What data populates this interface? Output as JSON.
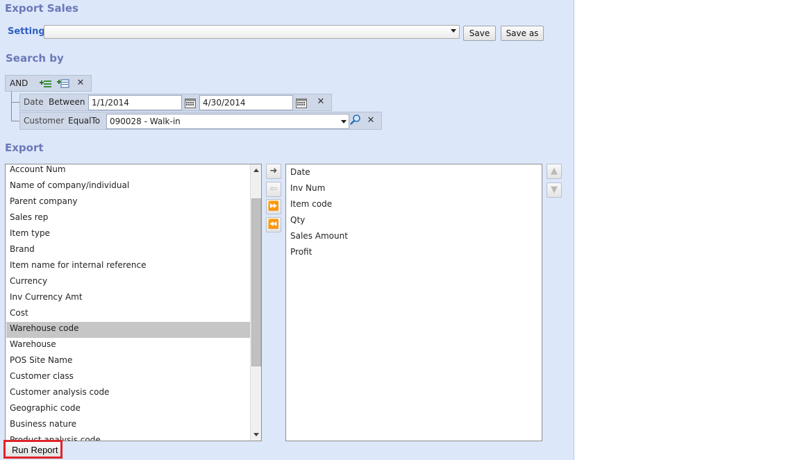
{
  "title": "Export Sales",
  "setting": {
    "label": "Setting:",
    "value": "",
    "save_label": "Save",
    "save_as_label": "Save as"
  },
  "search_by": {
    "heading": "Search by",
    "group_operator": "AND",
    "conditions": [
      {
        "field": "Date",
        "operator": "Between",
        "value1": "1/1/2014",
        "value2": "4/30/2014"
      },
      {
        "field": "Customer",
        "operator": "EqualTo",
        "value": "090028 - Walk-in"
      }
    ]
  },
  "export": {
    "heading": "Export",
    "available_fields": [
      "Account Num",
      "Name of company/individual",
      "Parent company",
      "Sales rep",
      "Item type",
      "Brand",
      "Item name for internal reference",
      "Currency",
      "Inv Currency Amt",
      "Cost",
      "Warehouse code",
      "Warehouse",
      "POS Site Name",
      "Customer class",
      "Customer analysis code",
      "Geographic code",
      "Business nature",
      "Product analysis code"
    ],
    "selected_available": "Warehouse code",
    "selected_fields": [
      "Date",
      "Inv Num",
      "Item code",
      "Qty",
      "Sales Amount",
      "Profit"
    ]
  },
  "run_report_label": "Run Report",
  "colors": {
    "panel_bg": "#dde7fa",
    "heading": "#6b78b8",
    "setting_label": "#2d5fbf",
    "highlight_border": "#e0232b"
  },
  "icons": [
    "dropdown-arrow-icon",
    "add-condition-icon",
    "add-group-icon",
    "close-icon",
    "calendar-icon",
    "search-icon",
    "move-right-icon",
    "move-left-icon",
    "move-all-right-icon",
    "move-all-left-icon",
    "move-up-icon",
    "move-down-icon"
  ]
}
